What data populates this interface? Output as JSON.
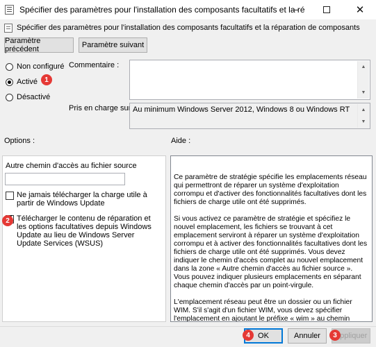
{
  "window": {
    "title": "Spécifier des paramètres pour l'installation des composants facultatifs et la réparation de compo...",
    "heading": "Spécifier des paramètres pour l'installation des composants facultatifs et la réparation de composants"
  },
  "nav": {
    "prev_label": "Paramètre précédent",
    "next_label": "Paramètre suivant"
  },
  "state": {
    "options": [
      "Non configuré",
      "Activé",
      "Désactivé"
    ],
    "selected": "Activé"
  },
  "comment": {
    "label": "Commentaire :",
    "value": ""
  },
  "supported": {
    "label": "Pris en charge sur :",
    "value": "Au minimum Windows Server 2012, Windows 8 ou Windows RT"
  },
  "options_section": {
    "heading": "Options :",
    "path_label": "Autre chemin d'accès au fichier source",
    "path_value": "",
    "never_download_label": "Ne jamais télécharger la charge utile à partir de Windows Update",
    "never_download_checked": false,
    "download_wu_label": "Télécharger le contenu de réparation et les options facultatives depuis Windows Update au lieu de Windows Server Update Services (WSUS)",
    "download_wu_checked": true
  },
  "help_section": {
    "heading": "Aide :",
    "p1": "Ce paramètre de stratégie spécifie les emplacements réseau qui permettront de réparer un système d'exploitation corrompu et d'activer des fonctionnalités facultatives dont les fichiers de charge utile ont été supprimés.",
    "p2": "Si vous activez ce paramètre de stratégie et spécifiez le nouvel emplacement, les fichiers se trouvant à cet emplacement serviront à réparer un système d'exploitation corrompu et à activer des fonctionnalités facultatives dont les fichiers de charge utile ont été supprimés. Vous devez indiquer le chemin d'accès complet au nouvel emplacement dans la zone « Autre chemin d'accès au fichier source ». Vous pouvez indiquer plusieurs emplacements en séparant chaque chemin d'accès par un point-virgule.",
    "p3": "L'emplacement réseau peut être un dossier ou un fichier WIM. S'il s'agit d'un fichier WIM, vous devez spécifier l'emplacement en ajoutant le préfixe « wim » au chemin d'accès et en ajoutant"
  },
  "footer": {
    "ok_label": "OK",
    "cancel_label": "Annuler",
    "apply_label": "Appliquer"
  },
  "badges": {
    "b1": "1",
    "b2": "2",
    "b3": "3",
    "b4": "4",
    "color": "#e53935"
  },
  "icons": {
    "app": "policy-icon",
    "heading": "policy-doc-icon"
  }
}
